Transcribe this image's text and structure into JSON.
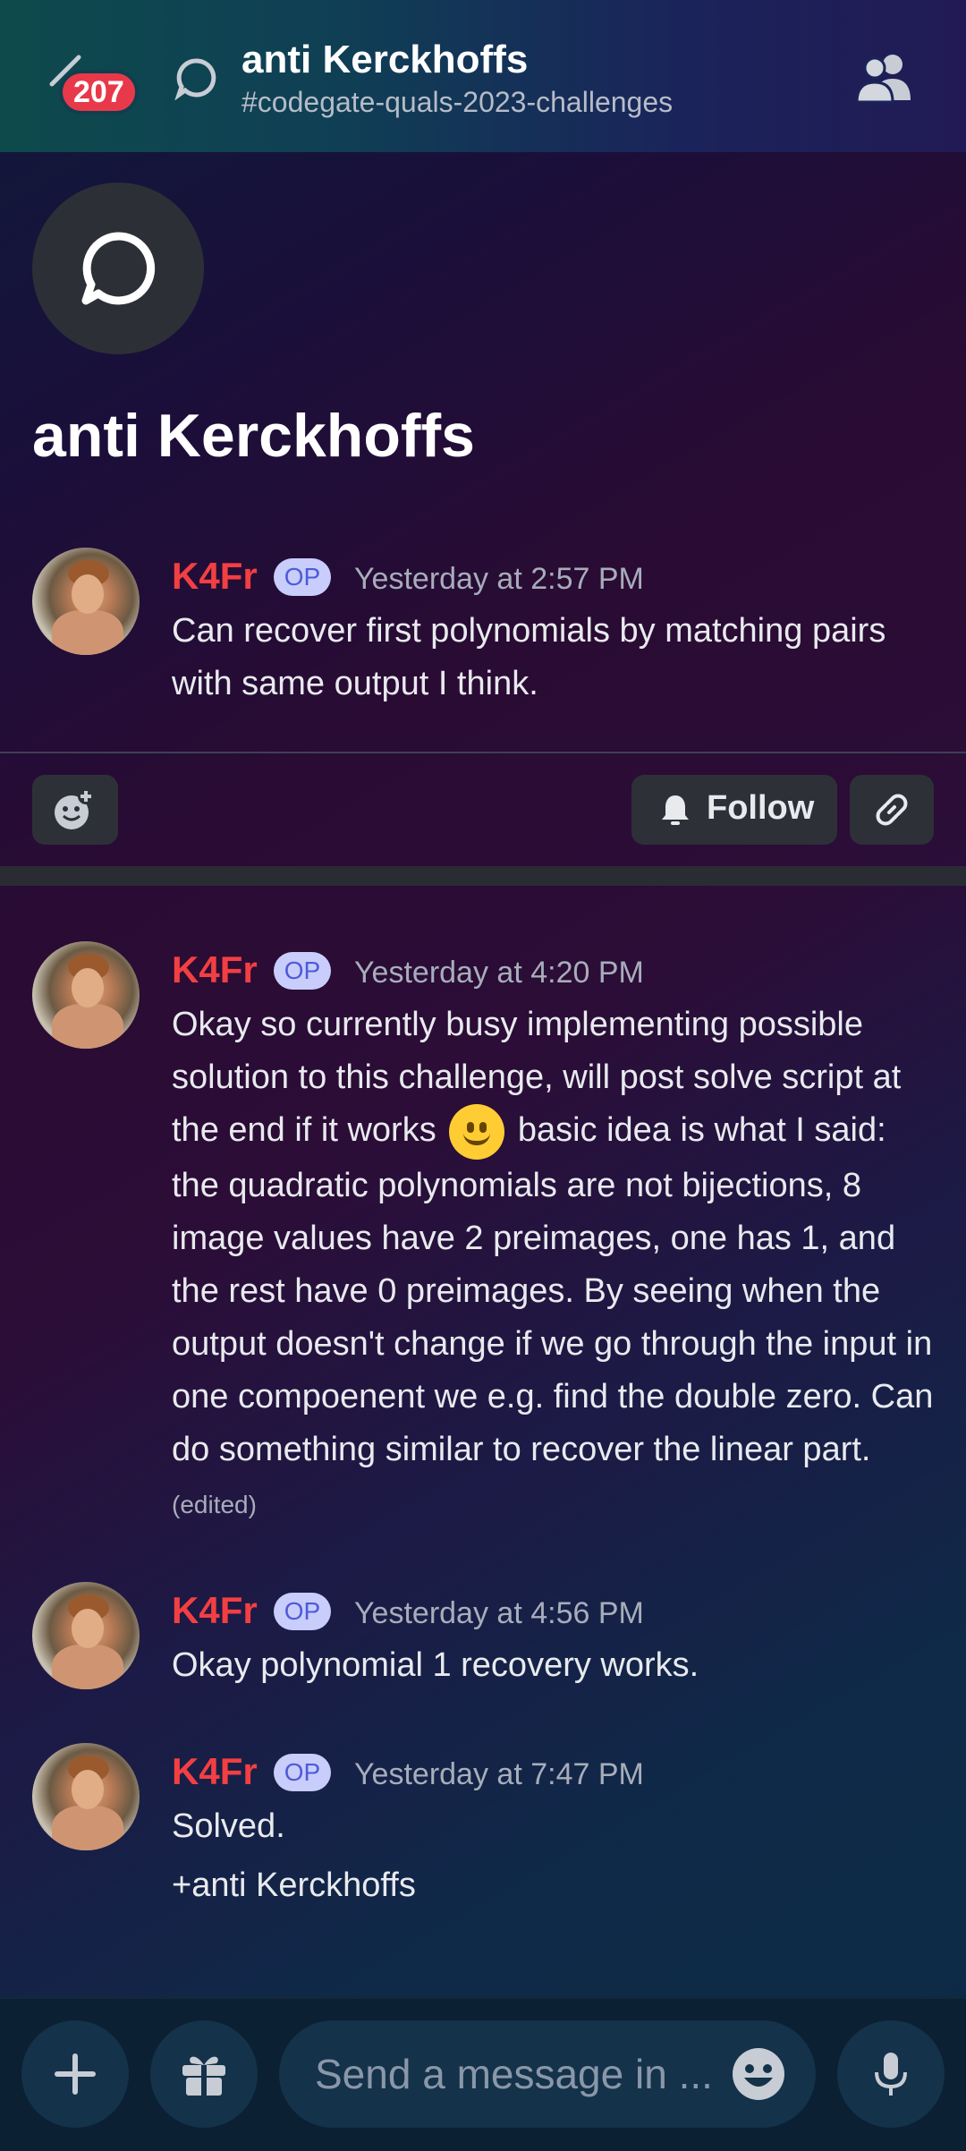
{
  "header": {
    "badge_count": "207",
    "title": "anti Kerckhoffs",
    "channel": "#codegate-quals-2023-challenges"
  },
  "thread": {
    "title": "anti Kerckhoffs"
  },
  "op_tag": "OP",
  "messages": [
    {
      "author": "K4Fr",
      "time": "Yesterday at 2:57 PM",
      "text": "Can recover first polynomials by matching pairs with same output I think."
    },
    {
      "author": "K4Fr",
      "time": "Yesterday at 4:20 PM",
      "text_before_emoji": "Okay so currently busy implementing possible solution to this challenge, will post solve script at the end if it works",
      "emoji": "slightly-smiling-face-emoji",
      "text_after_emoji": "basic idea is what I said: the quadratic polynomials are not bijections, 8 image values have 2 preimages, one has 1, and the rest have 0 preimages. By seeing when the output doesn't change if we go through the input in one compoenent we e.g. find the double zero. Can do something similar to recover the linear part.",
      "edited_label": "(edited)"
    },
    {
      "author": "K4Fr",
      "time": "Yesterday at 4:56 PM",
      "text": "Okay polynomial 1 recovery works."
    },
    {
      "author": "K4Fr",
      "time": "Yesterday at 7:47 PM",
      "text": "Solved.",
      "text2": "+anti Kerckhoffs"
    }
  ],
  "actions": {
    "follow_label": "Follow"
  },
  "composer": {
    "placeholder": "Send a message in ..."
  },
  "colors": {
    "author": "#f23f42",
    "op_tag_bg": "#c9cdfb",
    "badge": "#e8394a"
  }
}
